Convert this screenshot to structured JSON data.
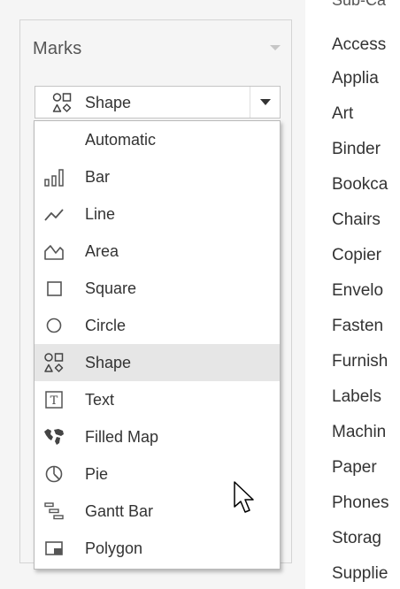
{
  "marks_card": {
    "title": "Marks",
    "selected_type": "Shape"
  },
  "mark_type_options": [
    {
      "label": "Automatic",
      "icon": "none"
    },
    {
      "label": "Bar",
      "icon": "bar-icon"
    },
    {
      "label": "Line",
      "icon": "line-icon"
    },
    {
      "label": "Area",
      "icon": "area-icon"
    },
    {
      "label": "Square",
      "icon": "square-icon"
    },
    {
      "label": "Circle",
      "icon": "circle-icon"
    },
    {
      "label": "Shape",
      "icon": "shape-icon",
      "selected": true
    },
    {
      "label": "Text",
      "icon": "text-icon"
    },
    {
      "label": "Filled Map",
      "icon": "filled-map-icon"
    },
    {
      "label": "Pie",
      "icon": "pie-icon"
    },
    {
      "label": "Gantt Bar",
      "icon": "gantt-bar-icon"
    },
    {
      "label": "Polygon",
      "icon": "polygon-icon"
    }
  ],
  "sub_category": {
    "header": "Sub-Ca",
    "items": [
      "Access",
      "Applia",
      "Art",
      "Binder",
      "Bookca",
      "Chairs",
      "Copier",
      "Envelo",
      "Fasten",
      "Furnish",
      "Labels",
      "Machin",
      "Paper",
      "Phones",
      "Storag",
      "Supplie"
    ]
  },
  "colors": {
    "panel_bg": "#f5f5f5",
    "selected_row": "#e6e6e6",
    "icon_gray": "#555555"
  }
}
